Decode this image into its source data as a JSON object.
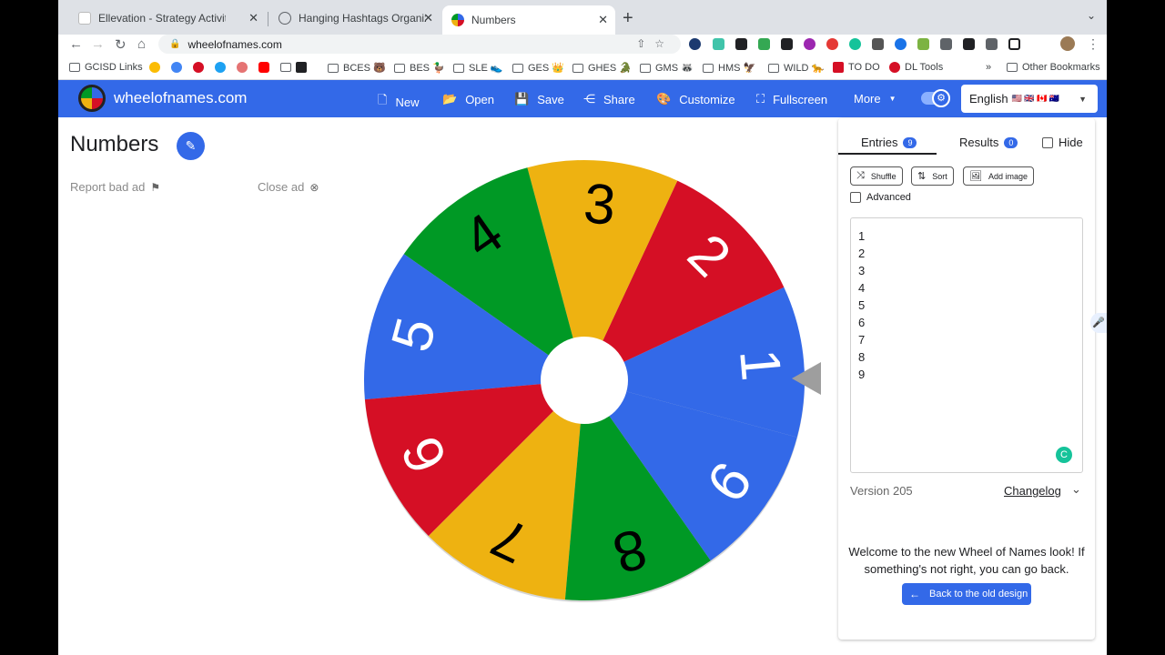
{
  "browser": {
    "tabs": [
      {
        "title": "Ellevation - Strategy Activity D",
        "close": "✕",
        "favicon_color": "#c43e1c"
      },
      {
        "title": "Hanging Hashtags Organizer",
        "close": "✕",
        "favicon_color": "#5f6368"
      },
      {
        "title": "Numbers",
        "close": "✕",
        "favicon_color": "#3369e8"
      }
    ],
    "url": "wheelofnames.com",
    "bookmarks": [
      {
        "label": "GCISD Links"
      },
      {
        "label": "BCES 🐻"
      },
      {
        "label": "BES 🦆"
      },
      {
        "label": "SLE 👟"
      },
      {
        "label": "GES 👑"
      },
      {
        "label": "GHES 🐊"
      },
      {
        "label": "GMS 🦝"
      },
      {
        "label": "HMS 🦅"
      },
      {
        "label": "WILD 🐆"
      },
      {
        "label": "TO DO"
      },
      {
        "label": "DL Tools"
      },
      {
        "label": "Other Bookmarks"
      }
    ],
    "bookmarks_overflow": "»"
  },
  "app": {
    "site_name": "wheelofnames.com",
    "nav": {
      "new": "New",
      "open": "Open",
      "save": "Save",
      "share": "Share",
      "customize": "Customize",
      "fullscreen": "Fullscreen",
      "more": "More"
    },
    "language": "English",
    "language_flags": "🇺🇸 🇬🇧 🇨🇦 🇦🇺"
  },
  "page": {
    "title": "Numbers",
    "report_ad": "Report bad ad",
    "close_ad": "Close ad"
  },
  "wheel": {
    "segments": [
      "1",
      "2",
      "3",
      "4",
      "5",
      "6",
      "7",
      "8",
      "9"
    ],
    "colors": [
      "#3369e8",
      "#d50f25",
      "#eeb211",
      "#009925"
    ],
    "label_colors": [
      "#ffffff",
      "#ffffff",
      "#000000",
      "#000000"
    ]
  },
  "panel": {
    "tabs": {
      "entries": "Entries",
      "entries_count": "9",
      "results": "Results",
      "results_count": "0",
      "hide": "Hide"
    },
    "buttons": {
      "shuffle": "Shuffle",
      "sort": "Sort",
      "add_image": "Add image"
    },
    "advanced": "Advanced",
    "entries": [
      "1",
      "2",
      "3",
      "4",
      "5",
      "6",
      "7",
      "8",
      "9"
    ],
    "version": "Version 205",
    "changelog": "Changelog",
    "welcome": "Welcome to the new Wheel of Names look! If something's not right, you can go back.",
    "back_button": "Back to the old design"
  }
}
